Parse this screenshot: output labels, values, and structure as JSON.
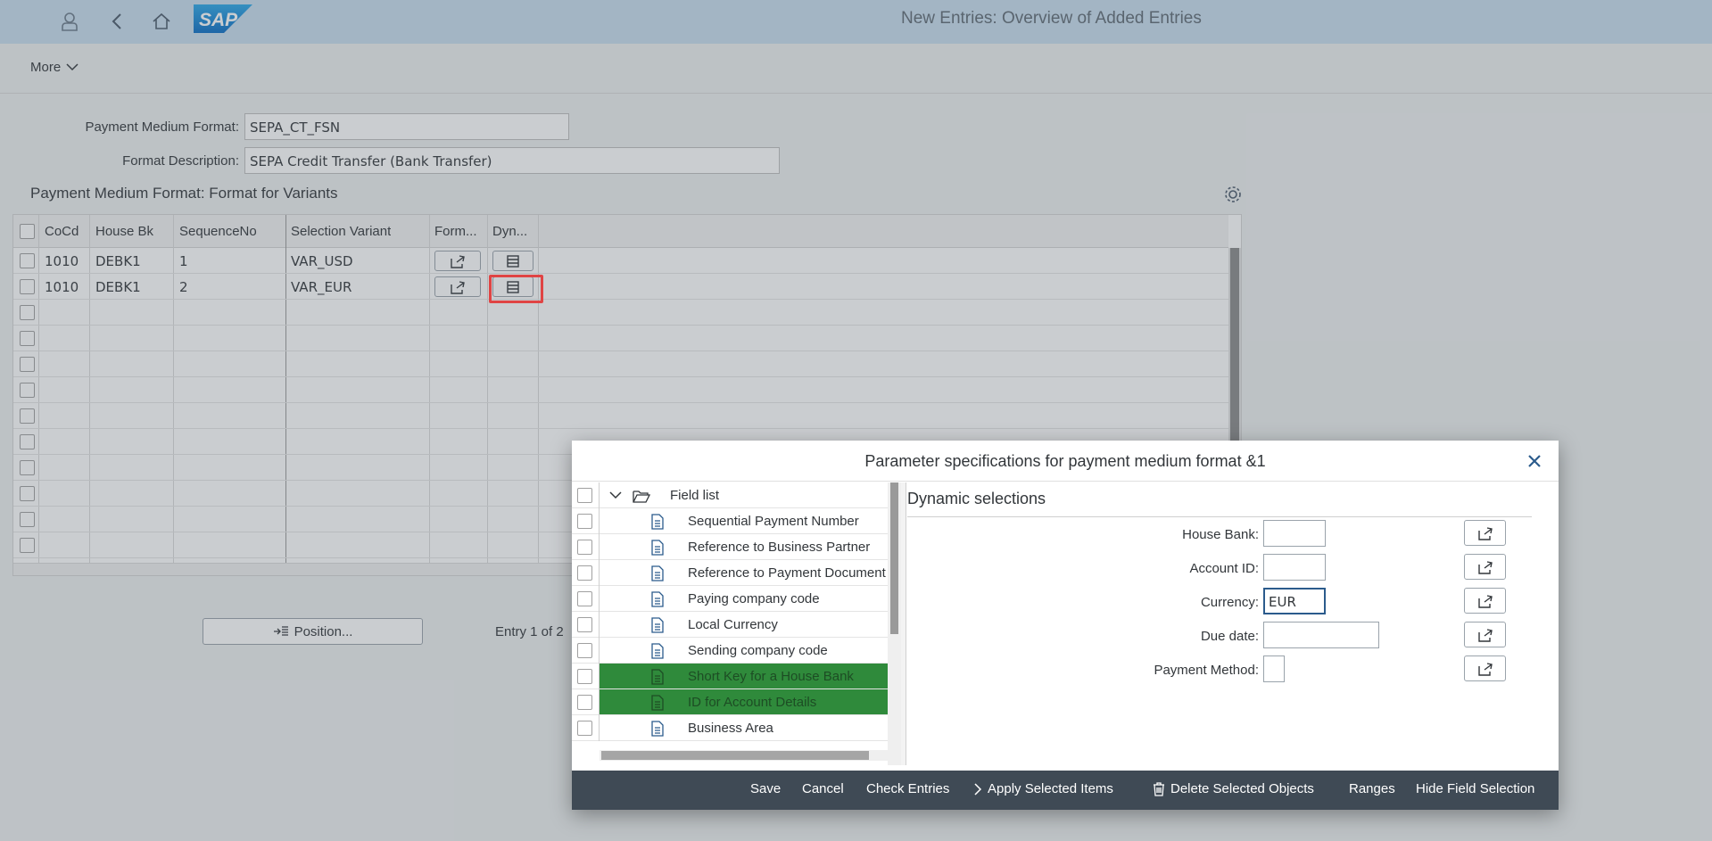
{
  "shell": {
    "title": "New Entries: Overview of Added Entries",
    "logo_text": "SAP"
  },
  "toolbar": {
    "more_label": "More"
  },
  "header": {
    "pmf_label": "Payment Medium Format:",
    "pmf_value": "SEPA_CT_FSN",
    "desc_label": "Format Description:",
    "desc_value": "SEPA Credit Transfer (Bank Transfer)"
  },
  "section": {
    "title": "Payment Medium Format: Format for Variants"
  },
  "table": {
    "columns": [
      "CoCd",
      "House Bk",
      "SequenceNo",
      "Selection Variant",
      "Form...",
      "Dyn..."
    ],
    "rows": [
      {
        "cocd": "1010",
        "house_bk": "DEBK1",
        "seq": "1",
        "variant": "VAR_USD"
      },
      {
        "cocd": "1010",
        "house_bk": "DEBK1",
        "seq": "2",
        "variant": "VAR_EUR"
      }
    ]
  },
  "below": {
    "position_label": "Position...",
    "entry_label": "Entry 1 of 2"
  },
  "dialog": {
    "title": "Parameter specifications for payment medium format &1",
    "tree": {
      "root": "Field list",
      "items": [
        "Sequential Payment Number",
        "Reference to Business Partner",
        "Reference to Payment Document",
        "Paying company code",
        "Local Currency",
        "Sending company code",
        "Short Key for a House Bank",
        "ID for Account Details",
        "Business Area"
      ],
      "selected_color": "#2f8a3b"
    },
    "dynamic": {
      "title": "Dynamic selections",
      "fields": [
        {
          "label": "House Bank:",
          "value": ""
        },
        {
          "label": "Account ID:",
          "value": ""
        },
        {
          "label": "Currency:",
          "value": "EUR"
        },
        {
          "label": "Due date:",
          "value": ""
        },
        {
          "label": "Payment Method:",
          "value": ""
        }
      ]
    },
    "footer": {
      "save": "Save",
      "cancel": "Cancel",
      "check": "Check Entries",
      "apply": "Apply Selected Items",
      "delete": "Delete Selected Objects",
      "ranges": "Ranges",
      "hide": "Hide Field Selection"
    }
  }
}
